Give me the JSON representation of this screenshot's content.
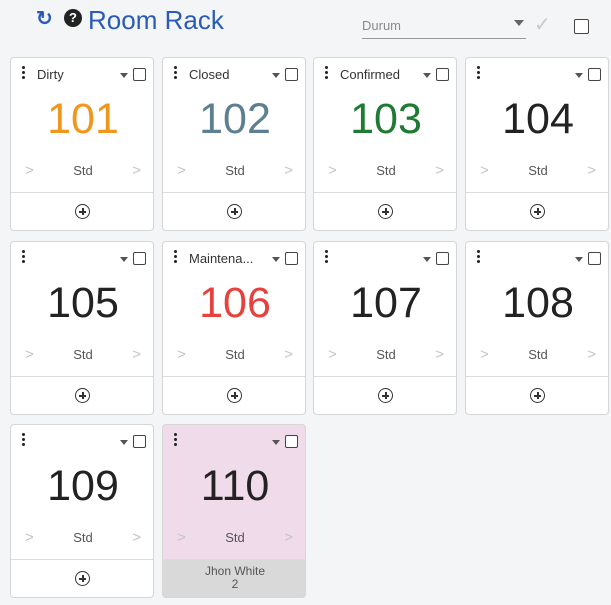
{
  "header": {
    "title": "Room Rack",
    "refresh_icon": "refresh-icon",
    "help_icon": "help-icon",
    "status_placeholder": "Durum",
    "check_icon": "checkmark-icon"
  },
  "colors": {
    "accent": "#2a5bb8",
    "dirty": "#f0961c",
    "closed": "#5c7f92",
    "confirmed": "#1f7a33",
    "maintenance": "#e8403c",
    "default": "#222222",
    "occupied_bg": "#efdbea"
  },
  "rooms": [
    {
      "number": "101",
      "status": "Dirty",
      "type": "Std"
    },
    {
      "number": "102",
      "status": "Closed",
      "type": "Std"
    },
    {
      "number": "103",
      "status": "Confirmed",
      "type": "Std"
    },
    {
      "number": "104",
      "status": "",
      "type": "Std"
    },
    {
      "number": "105",
      "status": "",
      "type": "Std"
    },
    {
      "number": "106",
      "status": "Maintena...",
      "type": "Std"
    },
    {
      "number": "107",
      "status": "",
      "type": "Std"
    },
    {
      "number": "108",
      "status": "",
      "type": "Std"
    },
    {
      "number": "109",
      "status": "",
      "type": "Std"
    },
    {
      "number": "110",
      "status": "",
      "type": "Std",
      "guest": "Jhon White",
      "guest_count": "2"
    }
  ],
  "nav": {
    "prev": ">",
    "next": ">"
  }
}
